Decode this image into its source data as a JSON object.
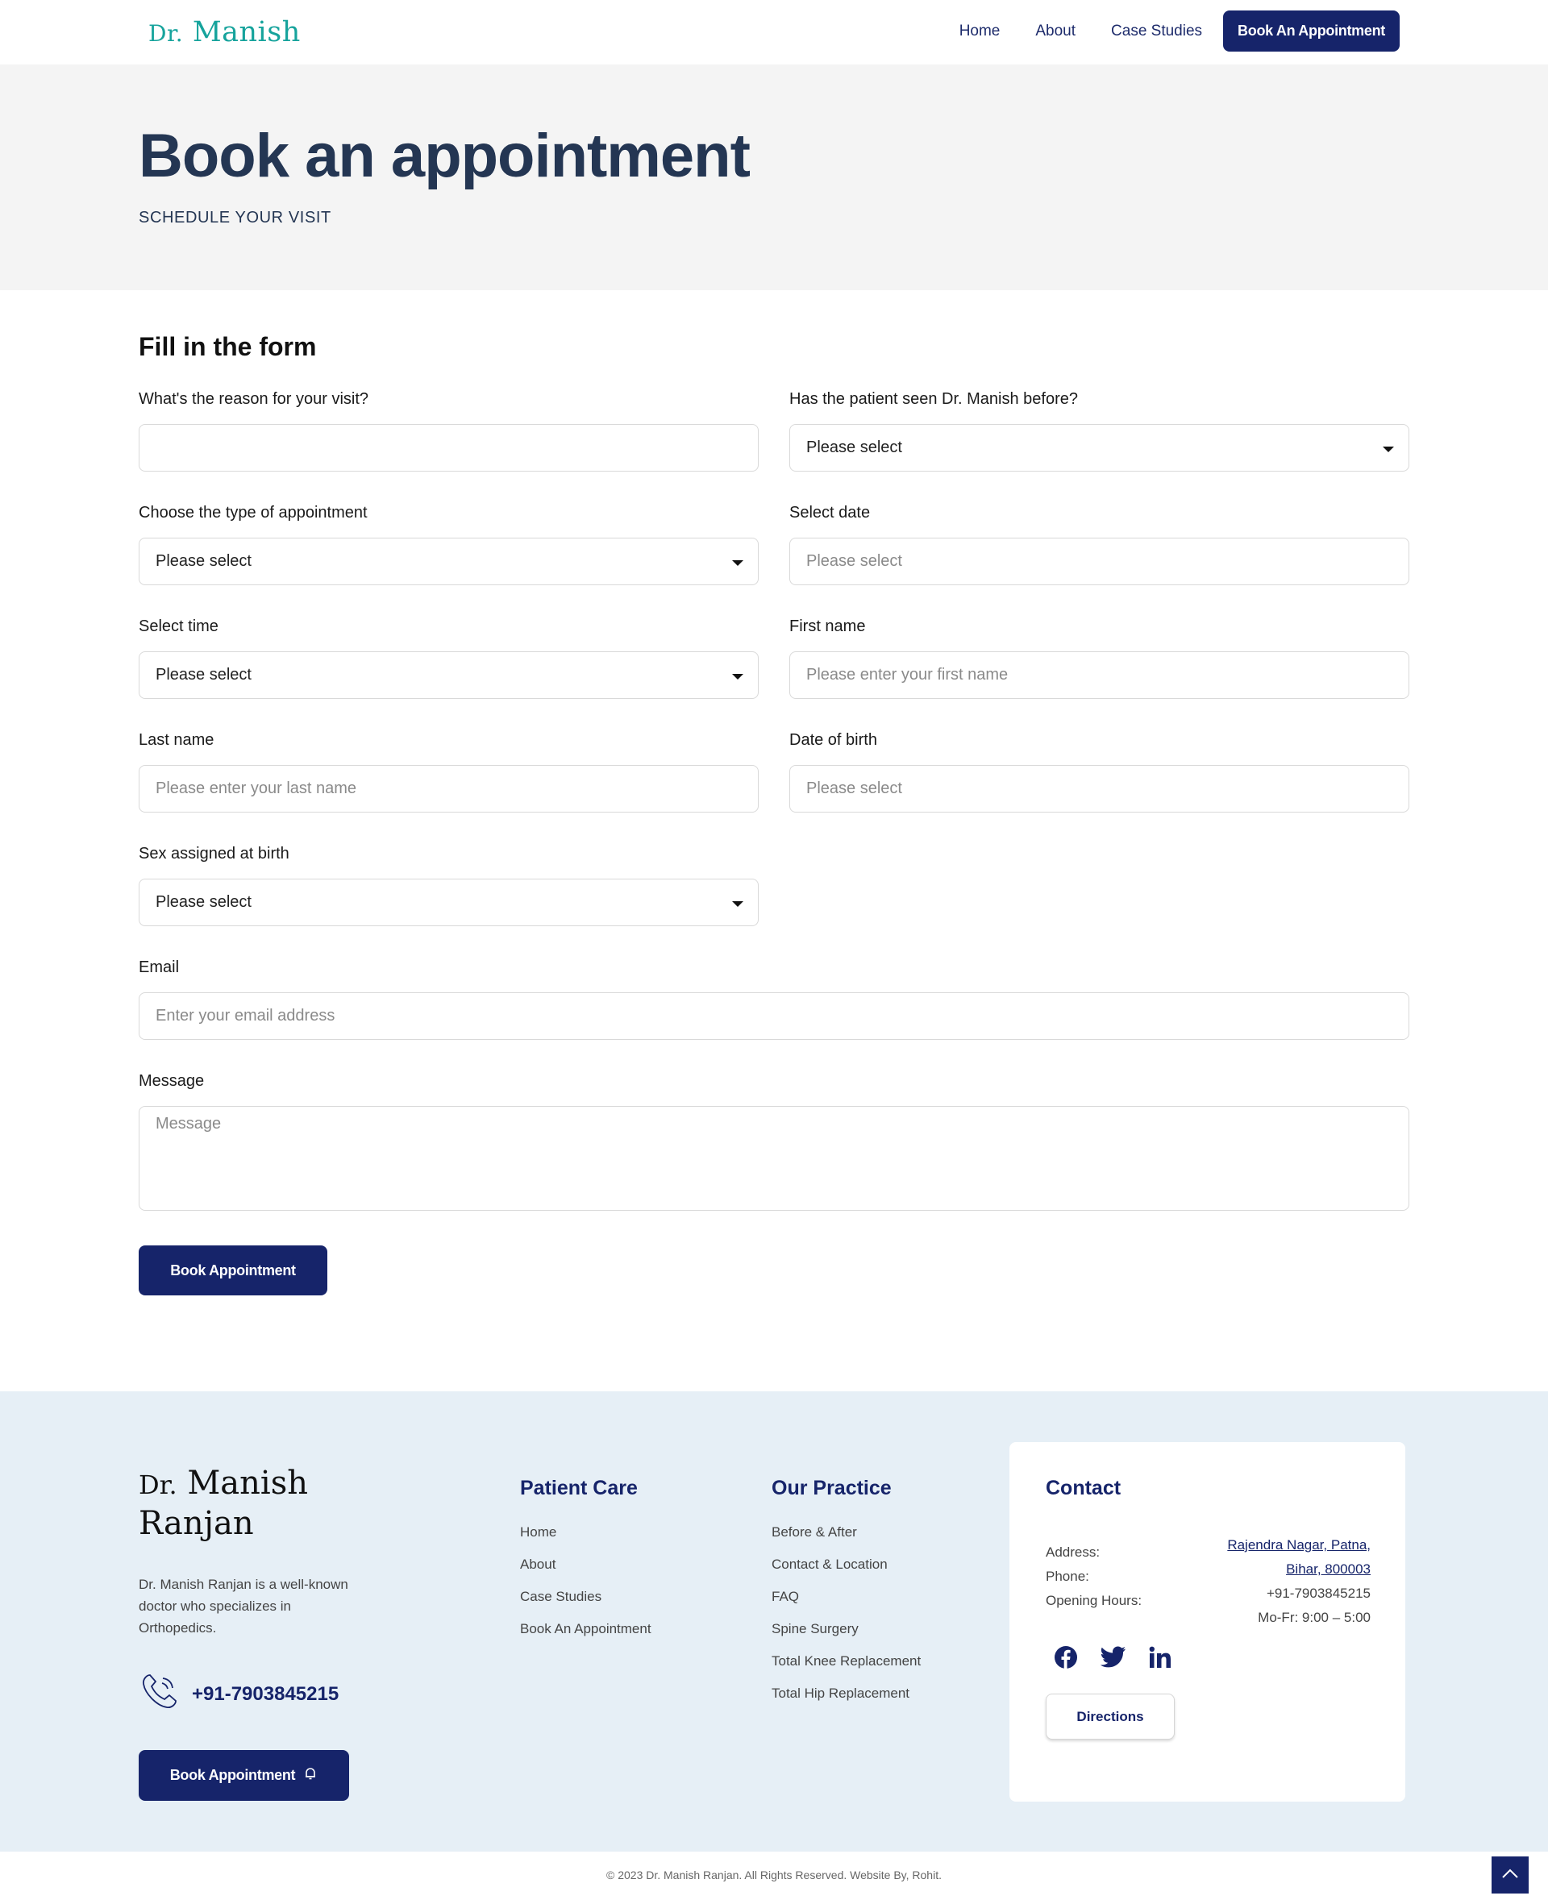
{
  "header": {
    "logo_dr": "Dr.",
    "logo_name": "Manish",
    "nav": [
      "Home",
      "About",
      "Case Studies"
    ],
    "cta": "Book An Appointment"
  },
  "hero": {
    "title": "Book an appointment",
    "subtitle": "SCHEDULE YOUR VISIT"
  },
  "form": {
    "title": "Fill in the form",
    "reason_label": "What's the reason for your visit?",
    "reason_value": "",
    "seen_label": "Has the patient seen Dr. Manish before?",
    "seen_value": "Please select",
    "type_label": "Choose the type of appointment",
    "type_value": "Please select",
    "date_label": "Select date",
    "date_placeholder": "Please select",
    "time_label": "Select time",
    "time_value": "Please select",
    "first_label": "First name",
    "first_placeholder": "Please enter your first name",
    "last_label": "Last name",
    "last_placeholder": "Please enter your last name",
    "dob_label": "Date of birth",
    "dob_placeholder": "Please select",
    "sex_label": "Sex assigned at birth",
    "sex_value": "Please select",
    "email_label": "Email",
    "email_placeholder": "Enter your email address",
    "message_label": "Message",
    "message_placeholder": "Message",
    "submit": "Book Appointment"
  },
  "footer": {
    "brand_dr": "Dr.",
    "brand_name1": "Manish",
    "brand_name2": "Ranjan",
    "description": "Dr. Manish Ranjan is a well-known doctor who specializes in Orthopedics.",
    "phone": "+91-7903845215",
    "book_btn": "Book Appointment",
    "patient_care": {
      "title": "Patient Care",
      "items": [
        "Home",
        "About",
        "Case Studies",
        "Book An Appointment"
      ]
    },
    "our_practice": {
      "title": "Our Practice",
      "items": [
        "Before & After",
        "Contact & Location",
        "FAQ",
        "Spine Surgery",
        "Total Knee Replacement",
        "Total Hip Replacement"
      ]
    },
    "contact": {
      "title": "Contact",
      "address_label": "Address:",
      "phone_label": "Phone:",
      "hours_label": "Opening Hours:",
      "address_line1": "Rajendra Nagar, Patna,",
      "address_line2": "Bihar, 800003",
      "phone": "+91-7903845215",
      "hours": "Mo-Fr: 9:00 – 5:00",
      "socials": [
        "facebook-icon",
        "twitter-icon",
        "linkedin-icon"
      ],
      "directions": "Directions"
    },
    "copyright": "© 2023 Dr. Manish Ranjan. All Rights Reserved. Website By, Rohit."
  },
  "colors": {
    "navy": "#16246a",
    "teal": "#16a39c",
    "hero_bg": "#f4f4f4",
    "footer_bg": "#e6eff6"
  }
}
